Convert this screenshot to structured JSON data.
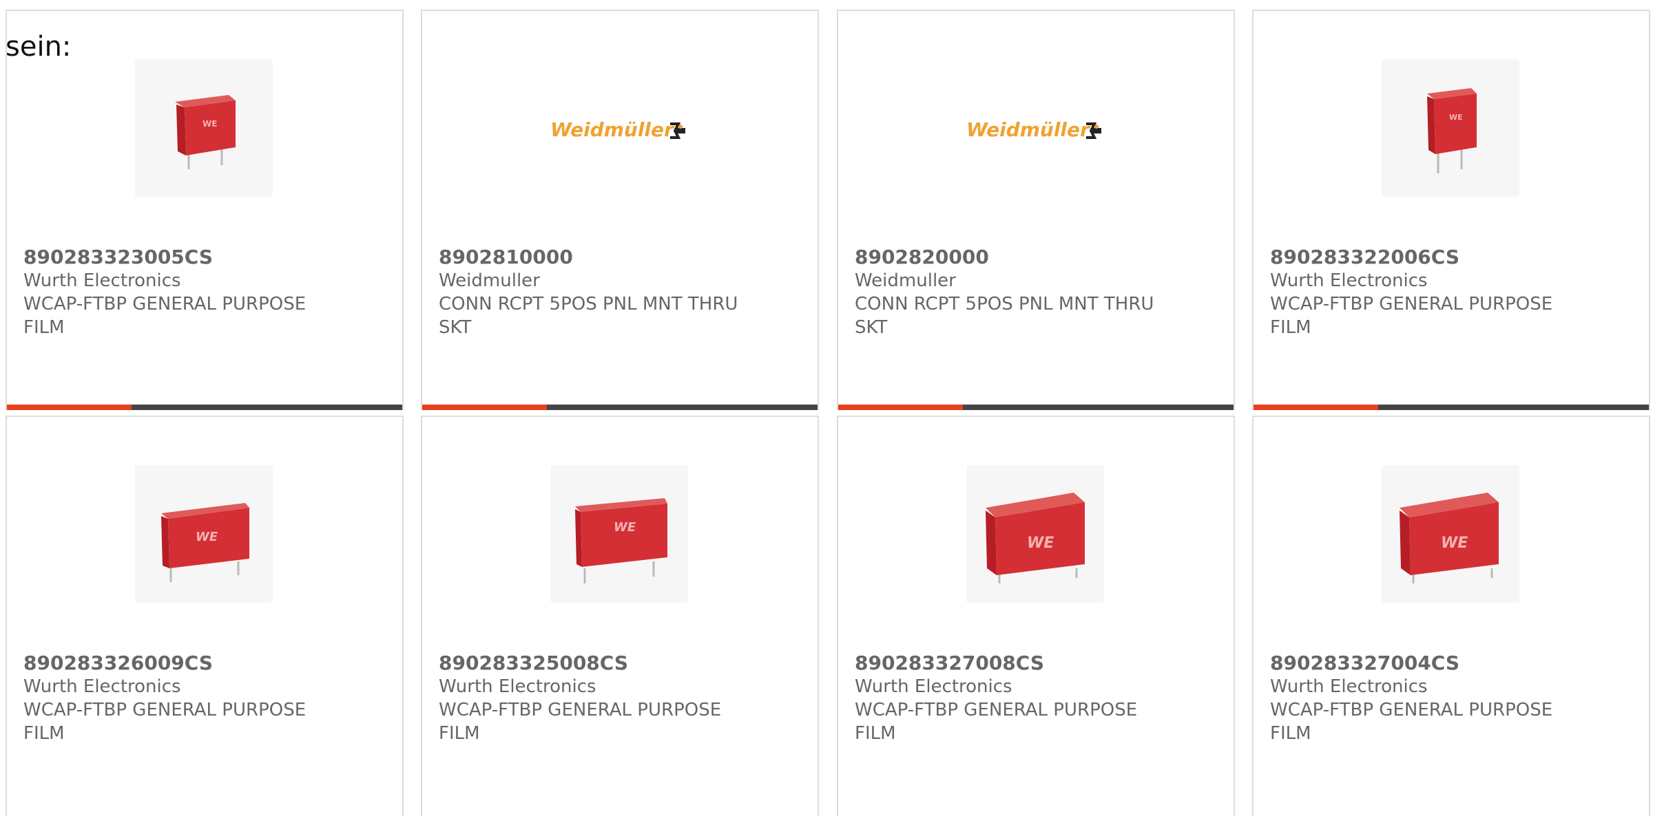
{
  "intro_text": "sein:",
  "accent_color": "#e8401c",
  "track_color": "#444444",
  "products": [
    {
      "part_number": "890283323005CS",
      "manufacturer": "Wurth Electronics",
      "description": "WCAP-FTBP GENERAL PURPOSE FILM",
      "image": "red-film-capacitor-upright-icon",
      "progress_fraction": 0.315
    },
    {
      "part_number": "8902810000",
      "manufacturer": "Weidmuller",
      "description": "CONN RCPT 5POS PNL MNT THRU SKT",
      "image": "weidmuller-logo",
      "logo_text": "Weidmüller",
      "progress_fraction": 0.315
    },
    {
      "part_number": "8902820000",
      "manufacturer": "Weidmuller",
      "description": "CONN RCPT 5POS PNL MNT THRU SKT",
      "image": "weidmuller-logo",
      "logo_text": "Weidmüller",
      "progress_fraction": 0.315
    },
    {
      "part_number": "890283322006CS",
      "manufacturer": "Wurth Electronics",
      "description": "WCAP-FTBP GENERAL PURPOSE FILM",
      "image": "red-film-capacitor-narrow-icon",
      "progress_fraction": 0.315
    },
    {
      "part_number": "890283326009CS",
      "manufacturer": "Wurth Electronics",
      "description": "WCAP-FTBP GENERAL PURPOSE FILM",
      "image": "red-film-capacitor-wide-icon"
    },
    {
      "part_number": "890283325008CS",
      "manufacturer": "Wurth Electronics",
      "description": "WCAP-FTBP GENERAL PURPOSE FILM",
      "image": "red-film-capacitor-wide-icon"
    },
    {
      "part_number": "890283327008CS",
      "manufacturer": "Wurth Electronics",
      "description": "WCAP-FTBP GENERAL PURPOSE FILM",
      "image": "red-film-capacitor-large-icon"
    },
    {
      "part_number": "890283327004CS",
      "manufacturer": "Wurth Electronics",
      "description": "WCAP-FTBP GENERAL PURPOSE FILM",
      "image": "red-film-capacitor-large-icon"
    }
  ]
}
